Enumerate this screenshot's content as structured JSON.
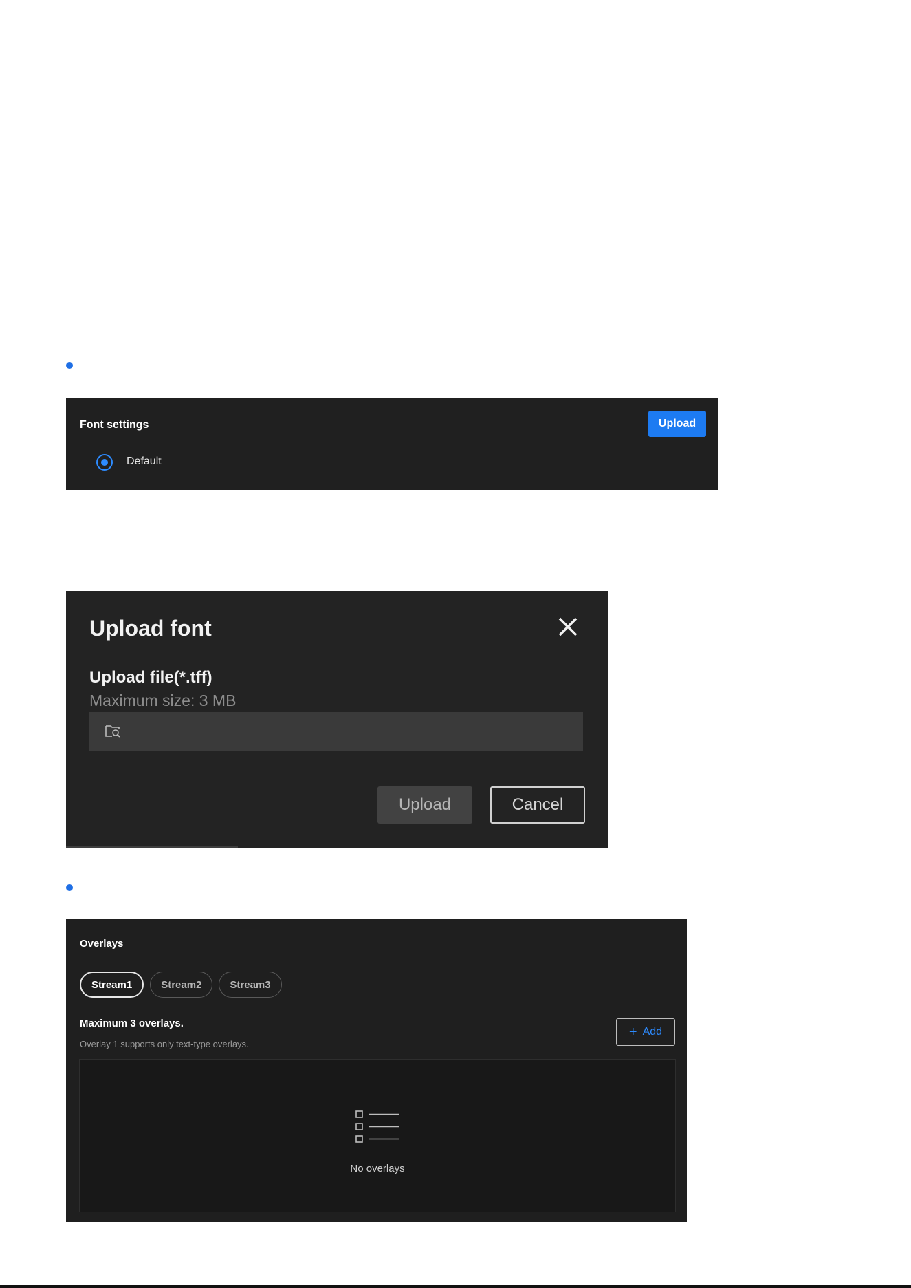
{
  "font_settings": {
    "title": "Font settings",
    "upload_label": "Upload",
    "radio_option": "Default",
    "radio_selected": true
  },
  "upload_dialog": {
    "title": "Upload font",
    "field_label": "Upload file(*.tff)",
    "field_hint": "Maximum size: 3 MB",
    "file_value": "",
    "upload_label": "Upload",
    "cancel_label": "Cancel",
    "icons": [
      "close-icon",
      "folder-search-icon"
    ]
  },
  "overlays": {
    "title": "Overlays",
    "tabs": [
      {
        "label": "Stream1",
        "active": true
      },
      {
        "label": "Stream2",
        "active": false
      },
      {
        "label": "Stream3",
        "active": false
      }
    ],
    "max_label": "Maximum 3 overlays.",
    "sub_label": "Overlay 1 supports only text-type overlays.",
    "add_label": "Add",
    "empty_text": "No overlays"
  },
  "colors": {
    "accent": "#1d7bf2",
    "panel_bg": "#202020",
    "bullet": "#1f6fe5"
  }
}
